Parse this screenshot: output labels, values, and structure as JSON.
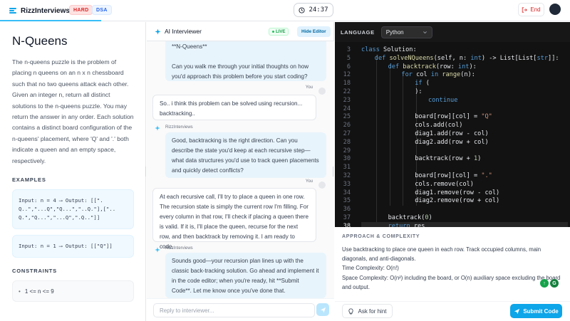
{
  "header": {
    "brand": "RizzInterviews",
    "difficulty": "HARD",
    "category": "DSA",
    "timer": "24:37",
    "end_label": "End"
  },
  "problem": {
    "title": "N-Queens",
    "description": "The n-queens puzzle is the problem of placing n queens on an n x n chessboard such that no two queens attack each other. Given an integer n, return all distinct solutions to the n-queens puzzle. You may return the answer in any order. Each solution contains a distinct board configuration of the n-queens' placement, where 'Q' and '.' both indicate a queen and an empty space, respectively.",
    "examples_label": "EXAMPLES",
    "examples": [
      "Input: n = 4 ⟶ Output: [[\".Q..\",\"...Q\",\"Q...\",\"..Q.\"],[\"..Q.\",\"Q...\",\"...Q\",\".Q..\"]]",
      "Input: n = 1 ⟶ Output: [[\"Q\"]]"
    ],
    "constraints_label": "CONSTRAINTS",
    "constraints": [
      "1 <= n <= 9"
    ]
  },
  "chat": {
    "title": "AI Interviewer",
    "live_label": "LIVE",
    "hide_editor_label": "Hide Editor",
    "messages": [
      {
        "role": "ai",
        "sender": "",
        "text": "**N-Queens**\n\nCan you walk me through your initial thoughts on how you'd approach this problem before you start coding?"
      },
      {
        "role": "user",
        "sender": "You",
        "text": "So.. i think this problem can be solved using recursion... backtracking.."
      },
      {
        "role": "ai",
        "sender": "RizzInterviews",
        "text": "Good, backtracking is the right direction. Can you describe the state you'd keep at each recursive step—what data structures you'd use to track queen placements and quickly detect conflicts?"
      },
      {
        "role": "user",
        "sender": "You",
        "text": "At each recursive call, I'll try to place a queen in one row. The recursion state is simply the current row I'm filling. For every column in that row, I'll check if placing a queen there is valid. If it is, I'll place the queen, recurse for the next row, and then backtrack by removing it. I am ready to code."
      },
      {
        "role": "ai",
        "sender": "RizzInterviews",
        "text": "Sounds good—your recursion plan lines up with the classic back-tracking solution. Go ahead and implement it in the code editor; when you're ready, hit **Submit Code**. Let me know once you've done that."
      }
    ],
    "input_placeholder": "Reply to interviewer..."
  },
  "editor": {
    "language_label": "LANGUAGE",
    "language": "Python",
    "lines": [
      {
        "n": "3",
        "indent": 0,
        "parts": [
          [
            "kw",
            "class "
          ],
          [
            "t",
            "Solution:"
          ]
        ]
      },
      {
        "n": "5",
        "indent": 1,
        "parts": [
          [
            "kw",
            "def "
          ],
          [
            "fn",
            "solveNQueens"
          ],
          [
            "t",
            "(self, n: "
          ],
          [
            "kw",
            "int"
          ],
          [
            "t",
            ") -> List[List["
          ],
          [
            "kw",
            "str"
          ],
          [
            "t",
            "]]:"
          ]
        ]
      },
      {
        "n": "6",
        "indent": 2,
        "parts": [
          [
            "kw",
            "def "
          ],
          [
            "fn",
            "backtrack"
          ],
          [
            "t",
            "(row: "
          ],
          [
            "kw",
            "int"
          ],
          [
            "t",
            "):"
          ]
        ]
      },
      {
        "n": "12",
        "indent": 3,
        "parts": [
          [
            "kw",
            "for "
          ],
          [
            "t",
            "col "
          ],
          [
            "kw",
            "in "
          ],
          [
            "fn",
            "range"
          ],
          [
            "t",
            "(n):"
          ]
        ]
      },
      {
        "n": "18",
        "indent": 4,
        "parts": [
          [
            "kw",
            "if "
          ],
          [
            "t",
            "("
          ]
        ]
      },
      {
        "n": "22",
        "indent": 4,
        "parts": [
          [
            "t",
            "):"
          ]
        ]
      },
      {
        "n": "23",
        "indent": 5,
        "parts": [
          [
            "kw",
            "continue"
          ]
        ]
      },
      {
        "n": "24",
        "indent": 4,
        "parts": [
          [
            "t",
            ""
          ]
        ]
      },
      {
        "n": "25",
        "indent": 4,
        "parts": [
          [
            "t",
            "board[row][col] = "
          ],
          [
            "str",
            "\"Q\""
          ]
        ]
      },
      {
        "n": "26",
        "indent": 4,
        "parts": [
          [
            "t",
            "cols.add(col)"
          ]
        ]
      },
      {
        "n": "27",
        "indent": 4,
        "parts": [
          [
            "t",
            "diag1.add(row - col)"
          ]
        ]
      },
      {
        "n": "28",
        "indent": 4,
        "parts": [
          [
            "t",
            "diag2.add(row + col)"
          ]
        ]
      },
      {
        "n": "29",
        "indent": 4,
        "parts": [
          [
            "t",
            ""
          ]
        ]
      },
      {
        "n": "30",
        "indent": 4,
        "parts": [
          [
            "t",
            "backtrack(row + "
          ],
          [
            "num",
            "1"
          ],
          [
            "t",
            ")"
          ]
        ]
      },
      {
        "n": "31",
        "indent": 4,
        "parts": [
          [
            "t",
            ""
          ]
        ]
      },
      {
        "n": "32",
        "indent": 4,
        "parts": [
          [
            "t",
            "board[row][col] = "
          ],
          [
            "str",
            "\".\""
          ]
        ]
      },
      {
        "n": "33",
        "indent": 4,
        "parts": [
          [
            "t",
            "cols.remove(col)"
          ]
        ]
      },
      {
        "n": "34",
        "indent": 4,
        "parts": [
          [
            "t",
            "diag1.remove(row - col)"
          ]
        ]
      },
      {
        "n": "35",
        "indent": 4,
        "parts": [
          [
            "t",
            "diag2.remove(row + col)"
          ]
        ]
      },
      {
        "n": "36",
        "indent": 2,
        "parts": [
          [
            "t",
            ""
          ]
        ]
      },
      {
        "n": "37",
        "indent": 2,
        "parts": [
          [
            "t",
            "backtrack("
          ],
          [
            "num",
            "0"
          ],
          [
            "t",
            ")"
          ]
        ]
      },
      {
        "n": "38",
        "indent": 2,
        "parts": [
          [
            "kw",
            "return "
          ],
          [
            "t",
            "res"
          ]
        ]
      }
    ]
  },
  "approach": {
    "heading": "APPROACH & COMPLEXITY",
    "lines": [
      "Use backtracking to place one queen in each row. Track occupied columns, main diagonals, and anti-diagonals.",
      "Time Complexity: O(n!)",
      "Space Complexity: O(n²) including the board, or O(n) auxiliary space excluding the board and output."
    ]
  },
  "actions": {
    "hint_label": "Ask for hint",
    "submit_label": "Submit Code"
  },
  "colors": {
    "accent": "#0ea5e9",
    "hard": "#dc2626",
    "live": "#16a34a"
  }
}
